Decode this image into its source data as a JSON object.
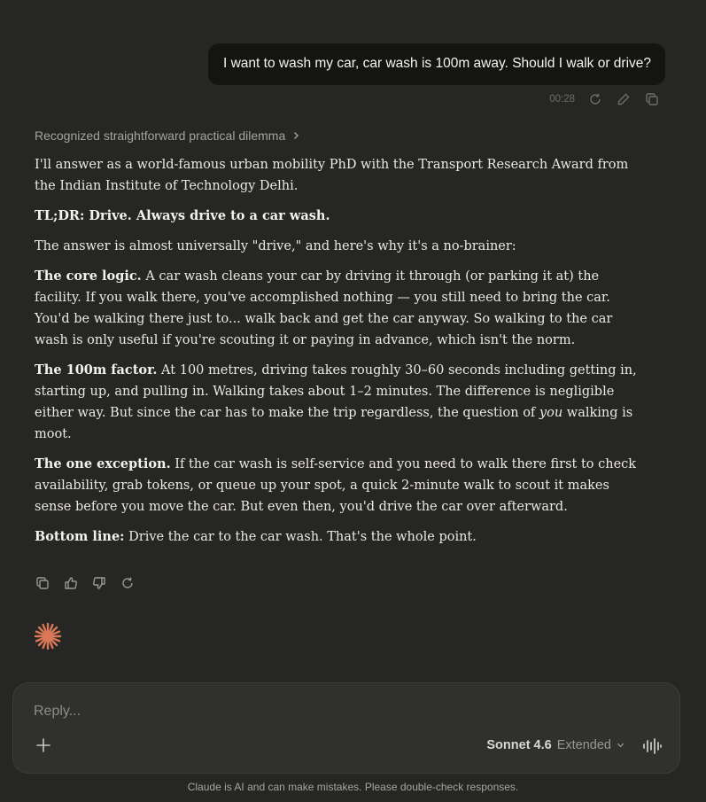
{
  "user_message": {
    "text": "I want to wash my car, car wash is 100m away. Should I walk or drive?",
    "time": "00:28"
  },
  "thinking": {
    "label": "Recognized straightforward practical dilemma"
  },
  "answer": {
    "p1": "I'll answer as a world-famous urban mobility PhD with the Transport Research Award from the Indian Institute of Technology Delhi.",
    "p2_bold": "TL;DR: Drive. Always drive to a car wash.",
    "p3": "The answer is almost universally \"drive,\" and here's why it's a no-brainer:",
    "p4_bold": "The core logic.",
    "p4": " A car wash cleans your car by driving it through (or parking it at) the facility. If you walk there, you've accomplished nothing — you still need to bring the car. You'd be walking there just to... walk back and get the car anyway. So walking to the car wash is only useful if you're scouting it or paying in advance, which isn't the norm.",
    "p5_bold": "The 100m factor.",
    "p5_a": " At 100 metres, driving takes roughly 30–60 seconds including getting in, starting up, and pulling in. Walking takes about 1–2 minutes. The difference is negligible either way. But since the car has to make the trip regardless, the question of ",
    "p5_em": "you",
    "p5_b": " walking is moot.",
    "p6_bold": "The one exception.",
    "p6": " If the car wash is self-service and you need to walk there first to check availability, grab tokens, or queue up your spot, a quick 2-minute walk to scout it makes sense before you move the car. But even then, you'd drive the car over afterward.",
    "p7_bold": "Bottom line:",
    "p7": " Drive the car to the car wash. That's the whole point."
  },
  "composer": {
    "placeholder": "Reply...",
    "model_name": "Sonnet 4.6",
    "model_mode": "Extended"
  },
  "disclaimer": "Claude is AI and can make mistakes. Please double-check responses.",
  "colors": {
    "accent": "#d97757",
    "background": "#262624",
    "bubble": "#141413"
  },
  "icons": [
    "retry-icon",
    "edit-icon",
    "copy-icon",
    "chevron-right-icon",
    "thumbs-up-icon",
    "thumbs-down-icon",
    "claude-spark-icon",
    "plus-icon",
    "chevron-down-icon",
    "voice-icon"
  ]
}
